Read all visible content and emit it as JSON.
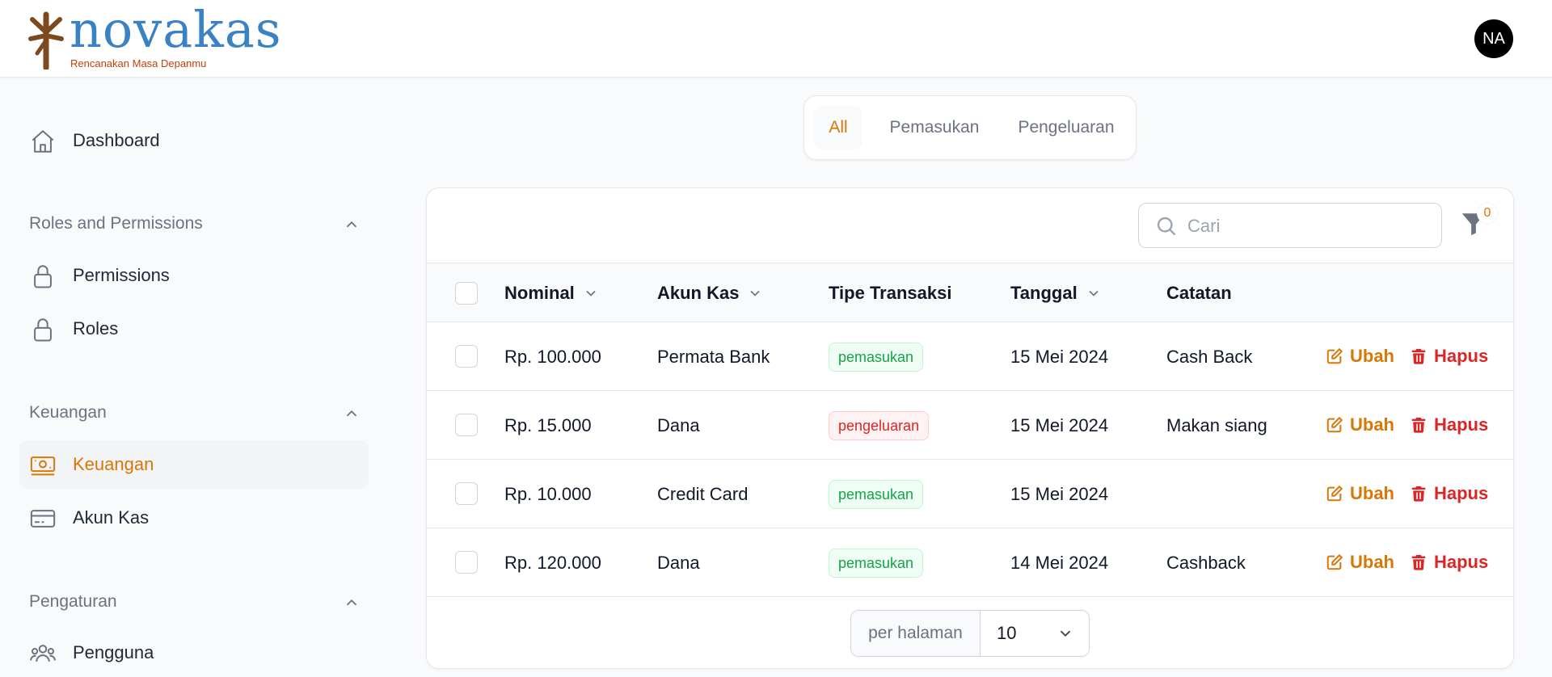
{
  "brand": {
    "name": "novakas",
    "tagline": "Rencanakan Masa Depanmu"
  },
  "user": {
    "initials": "NA"
  },
  "sidebar": {
    "dashboard": "Dashboard",
    "groups": [
      {
        "label": "Roles and Permissions",
        "items": [
          "Permissions",
          "Roles"
        ]
      },
      {
        "label": "Keuangan",
        "items": [
          "Keuangan",
          "Akun Kas"
        ]
      },
      {
        "label": "Pengaturan",
        "items": [
          "Pengguna"
        ]
      }
    ],
    "active": "Keuangan"
  },
  "tabs": [
    "All",
    "Pemasukan",
    "Pengeluaran"
  ],
  "active_tab": "All",
  "search": {
    "placeholder": "Cari"
  },
  "filter": {
    "count": "0"
  },
  "table": {
    "headers": [
      "Nominal",
      "Akun Kas",
      "Tipe Transaksi",
      "Tanggal",
      "Catatan"
    ],
    "rows": [
      {
        "nominal": "Rp. 100.000",
        "akun": "Permata Bank",
        "tipe": "pemasukan",
        "tanggal": "15 Mei 2024",
        "catatan": "Cash Back"
      },
      {
        "nominal": "Rp. 15.000",
        "akun": "Dana",
        "tipe": "pengeluaran",
        "tanggal": "15 Mei 2024",
        "catatan": "Makan siang"
      },
      {
        "nominal": "Rp. 10.000",
        "akun": "Credit Card",
        "tipe": "pemasukan",
        "tanggal": "15 Mei 2024",
        "catatan": ""
      },
      {
        "nominal": "Rp. 120.000",
        "akun": "Dana",
        "tipe": "pemasukan",
        "tanggal": "14 Mei 2024",
        "catatan": "Cashback"
      }
    ],
    "actions": {
      "edit": "Ubah",
      "delete": "Hapus"
    }
  },
  "pagination": {
    "label": "per halaman",
    "value": "10"
  },
  "colors": {
    "accent": "#d97706",
    "brand": "#3b82c4",
    "income": "#16a34a",
    "expense": "#dc2626"
  }
}
